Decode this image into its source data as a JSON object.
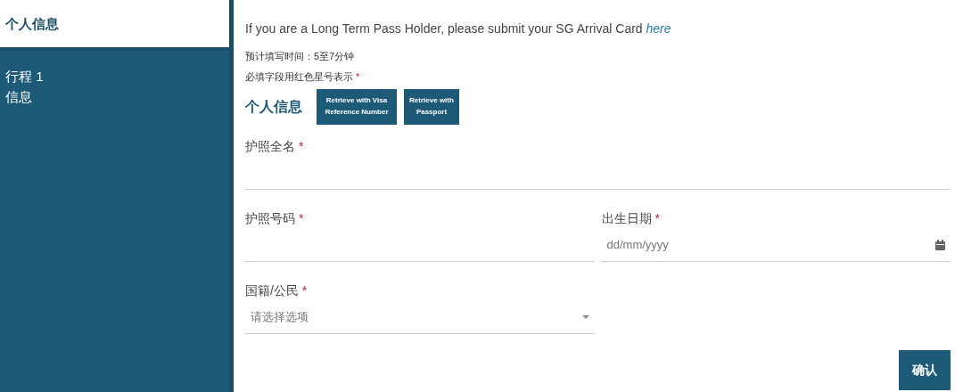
{
  "sidebar": {
    "items": [
      {
        "label": "个人信息",
        "selected": true
      },
      {
        "label": "行程 1 信息",
        "selected": false
      }
    ]
  },
  "notice": {
    "text": "If you are a Long Term Pass Holder, please submit your SG Arrival Card",
    "link": "here"
  },
  "notes": [
    {
      "text": "预计填写时间：5至7分钟"
    },
    {
      "text": "必填字段用红色星号表示",
      "mark": "*"
    }
  ],
  "section": {
    "title": "个人信息",
    "buttons": [
      "Retrieve with Visa Reference Number",
      "Retrieve with Passport"
    ]
  },
  "fields": [
    {
      "kind": "text",
      "label": "护照全名",
      "mark": "*",
      "full_width": true
    },
    {
      "kind": "text",
      "label": "护照号码",
      "mark": "*",
      "full_width": false
    },
    {
      "kind": "date",
      "label": "出生日期",
      "mark": "*",
      "placeholder": "dd/mm/yyyy",
      "full_width": false
    },
    {
      "kind": "select",
      "label": "国籍/公民",
      "mark": "*",
      "placeholder": "请选择选项",
      "full_width": false
    }
  ],
  "confirm_button": "确认"
}
